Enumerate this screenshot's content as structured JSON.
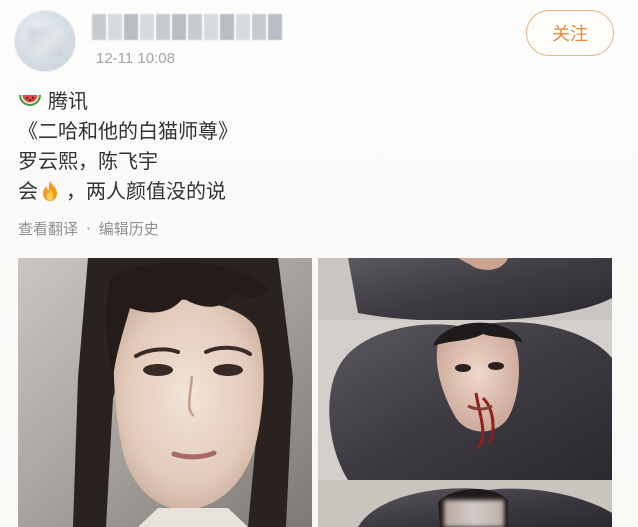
{
  "header": {
    "post_time": "12-11 10:08",
    "follow_label": "关注"
  },
  "post": {
    "line1": "腾讯",
    "line2": "《二哈和他的白猫师尊》",
    "line3": "罗云熙，陈飞宇",
    "line4_prefix": "会",
    "line4_suffix": "，两人颜值没的说",
    "emoji_line1": "watermelon-icon",
    "emoji_line4": "fire-icon"
  },
  "actions": {
    "translate": "查看翻译",
    "separator": "·",
    "edit_history": "编辑历史"
  },
  "colors": {
    "follow_accent": "#eb8a3c",
    "follow_border": "#e9b98a",
    "meta_gray": "#a5a5a5",
    "text": "#333333"
  }
}
